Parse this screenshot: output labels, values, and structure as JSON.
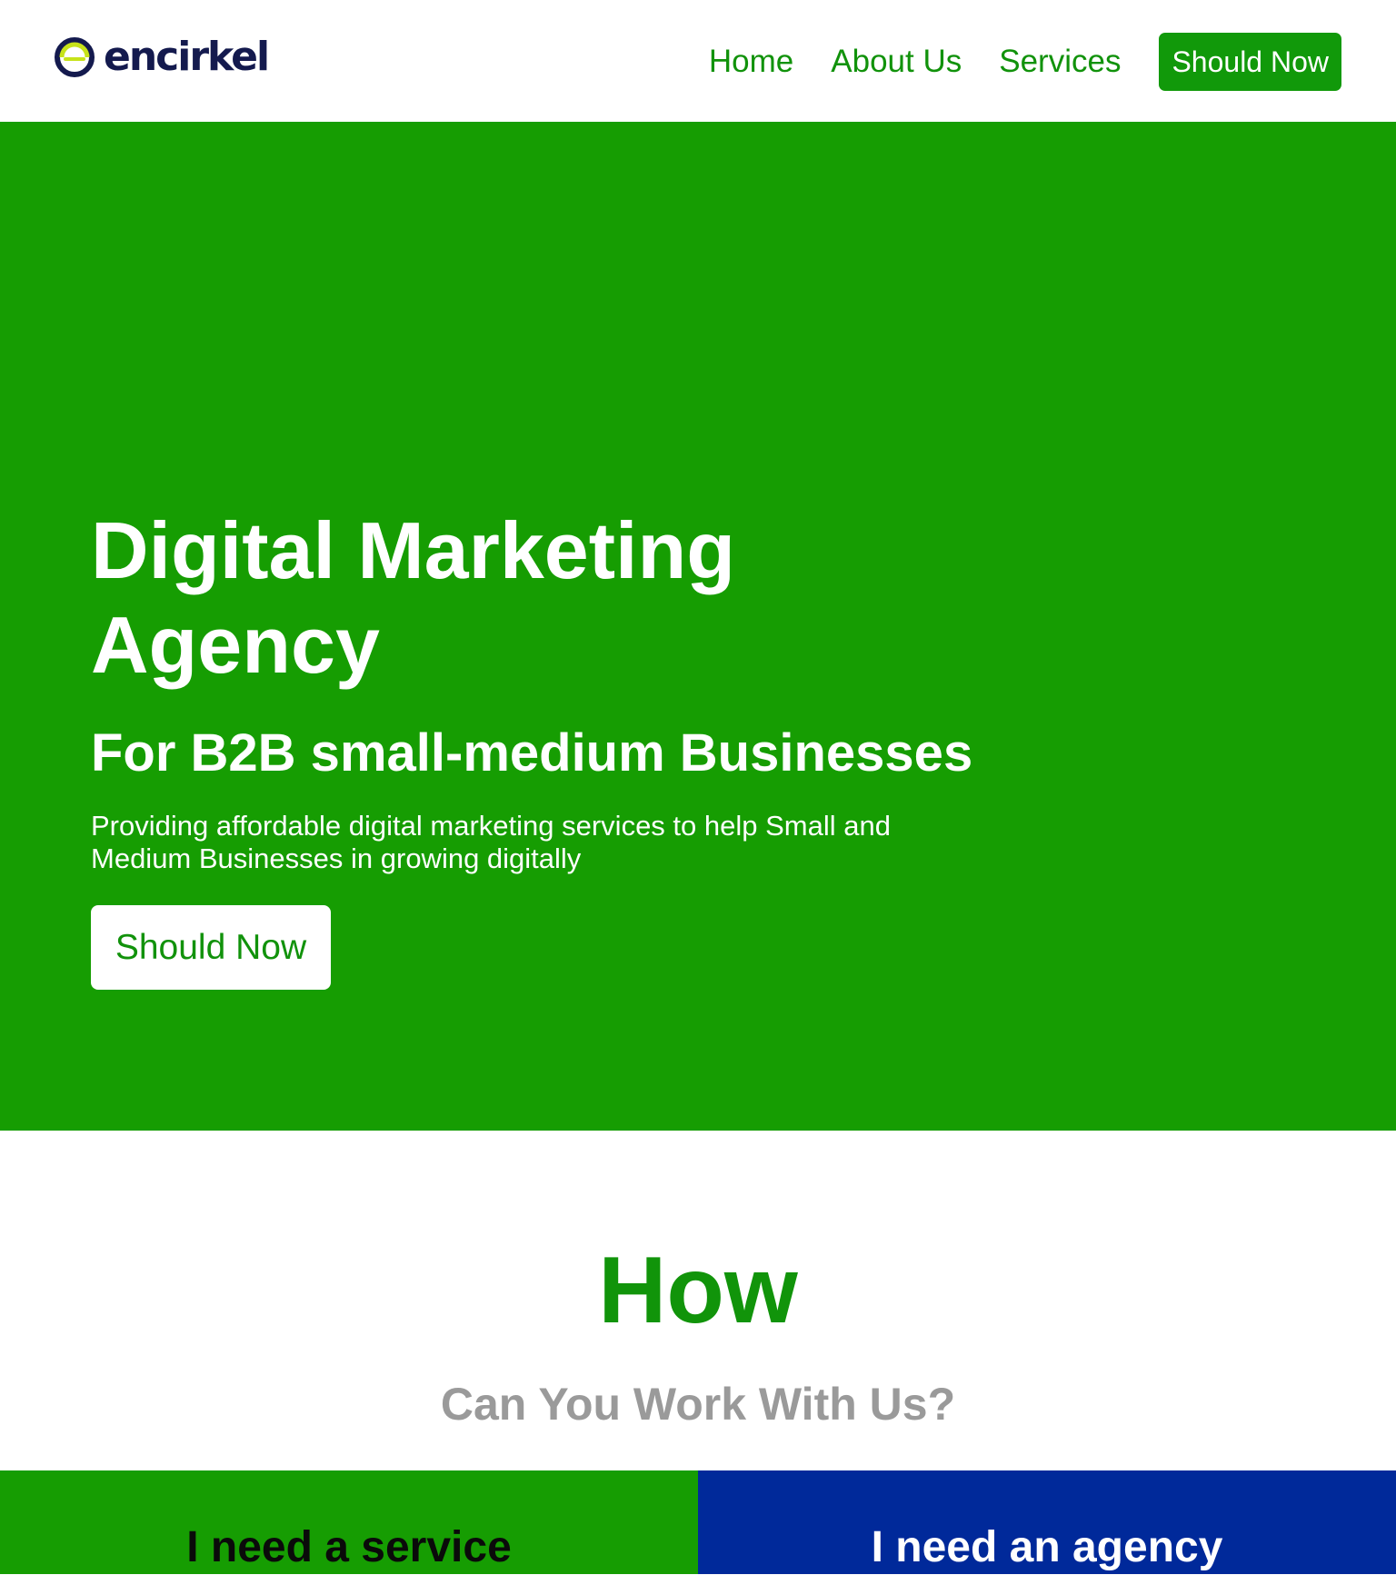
{
  "colors": {
    "brand_green": "#169d02",
    "nav_green": "#11920b",
    "agency_blue": "#00299a",
    "logo_navy": "#141a4e",
    "subtitle_gray": "#9a9a9a"
  },
  "header": {
    "logo_text": "encirkel",
    "logo_icon": "encirkel-ring-logo",
    "nav": {
      "home": "Home",
      "about": "About Us",
      "services": "Services",
      "cta": "Should Now"
    }
  },
  "hero": {
    "title": "Digital Marketing Agency",
    "subtitle": "For B2B small-medium Businesses",
    "description": "Providing affordable digital marketing services to help Small and Medium Businesses in growing digitally",
    "cta": "Should Now"
  },
  "how": {
    "title": "How",
    "subtitle": "Can You Work With Us?"
  },
  "options": {
    "service": "I need a service",
    "agency": "I need an agency"
  }
}
